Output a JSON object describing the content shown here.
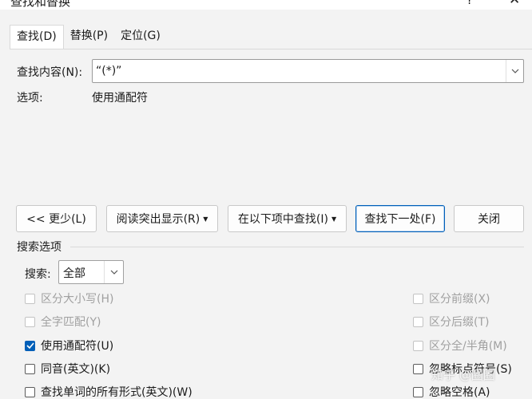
{
  "window": {
    "title": "查找和替换",
    "help_glyph": "?",
    "close_glyph": "✕"
  },
  "tabs": [
    {
      "label": "查找(D)",
      "active": true
    },
    {
      "label": "替换(P)",
      "active": false
    },
    {
      "label": "定位(G)",
      "active": false
    }
  ],
  "find": {
    "label": "查找内容(N):",
    "value": "“(*)”"
  },
  "options": {
    "label": "选项:",
    "value": "使用通配符"
  },
  "buttons": {
    "less": "<< 更少(L)",
    "highlight": "阅读突出显示(R)",
    "find_in": "在以下项中查找(I)",
    "find_next": "查找下一处(F)",
    "close": "关闭"
  },
  "search_options": {
    "heading": "搜索选项",
    "search_label": "搜索:",
    "search_value": "全部"
  },
  "checkboxes_left": [
    {
      "label": "区分大小写(H)",
      "checked": false,
      "disabled": true
    },
    {
      "label": "全字匹配(Y)",
      "checked": false,
      "disabled": true
    },
    {
      "label": "使用通配符(U)",
      "checked": true,
      "disabled": false
    },
    {
      "label": "同音(英文)(K)",
      "checked": false,
      "disabled": false
    },
    {
      "label": "查找单词的所有形式(英文)(W)",
      "checked": false,
      "disabled": false
    }
  ],
  "checkboxes_right": [
    {
      "label": "区分前缀(X)",
      "checked": false,
      "disabled": true
    },
    {
      "label": "区分后缀(T)",
      "checked": false,
      "disabled": true
    },
    {
      "label": "区分全/半角(M)",
      "checked": false,
      "disabled": true
    },
    {
      "label": "忽略标点符号(S)",
      "checked": false,
      "disabled": false
    },
    {
      "label": "忽略空格(A)",
      "checked": false,
      "disabled": false
    }
  ],
  "watermark": "知乎 @圈圈",
  "colors": {
    "accent": "#005fb8",
    "background": "#f3f3f3"
  }
}
